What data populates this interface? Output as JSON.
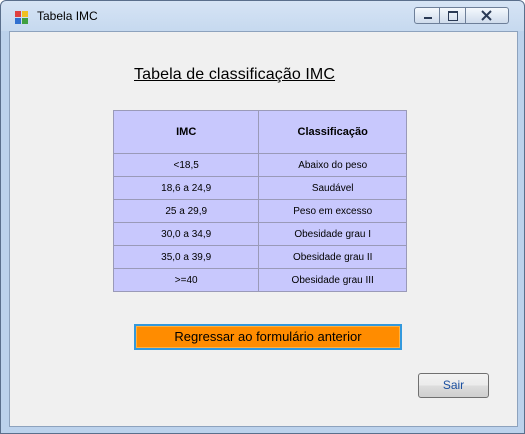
{
  "window": {
    "title": "Tabela IMC"
  },
  "heading": "Tabela de classificação IMC",
  "table": {
    "headers": [
      "IMC",
      "Classificação"
    ],
    "rows": [
      [
        "<18,5",
        "Abaixo do peso"
      ],
      [
        "18,6 a 24,9",
        "Saudável"
      ],
      [
        "25 a 29,9",
        "Peso em excesso"
      ],
      [
        "30,0 a 34,9",
        "Obesidade grau I"
      ],
      [
        "35,0 a 39,9",
        "Obesidade grau II"
      ],
      [
        ">=40",
        "Obesidade grau III"
      ]
    ]
  },
  "buttons": {
    "back_label": "Regressar ao formulário anterior",
    "exit_label": "Sair"
  },
  "colors": {
    "table_cell": "#c8c8fd",
    "back_button": "#ff8c00",
    "exit_text": "#1a4fa0"
  },
  "icons": {
    "app": "app-form-icon",
    "minimize": "minimize-icon",
    "maximize": "maximize-icon",
    "close": "close-icon"
  }
}
